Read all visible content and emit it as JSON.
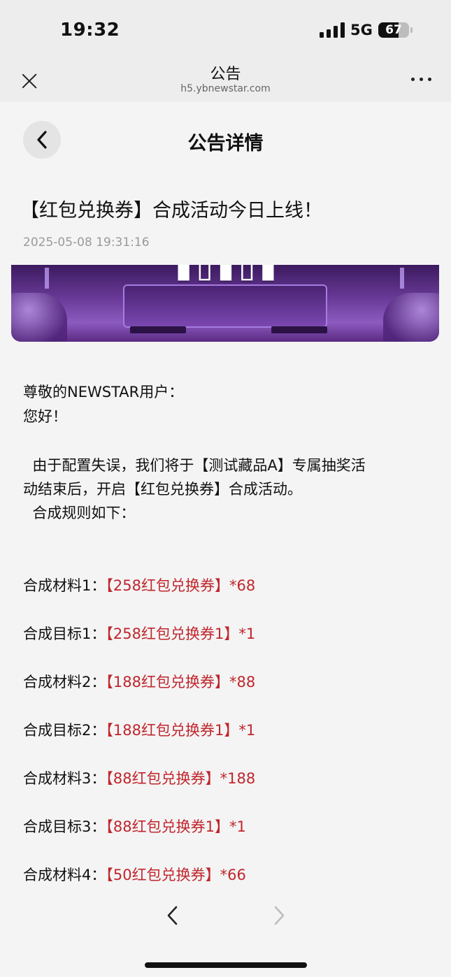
{
  "status_bar": {
    "time": "19:32",
    "network": "5G",
    "battery_level": 67,
    "battery_text": "67"
  },
  "browser": {
    "title": "公告",
    "url": "h5.ybnewstar.com"
  },
  "page": {
    "heading": "公告详情"
  },
  "article": {
    "title": "【红包兑换券】合成活动今日上线！",
    "date": "2025-05-08 19:31:16",
    "greeting_1": "尊敬的NEWSTAR用户：",
    "greeting_2": "您好！",
    "paragraph_line_1": "  由于配置失误，我们将于【测试藏品A】专属抽奖活",
    "paragraph_line_2": "动结束后，开启【红包兑换券】合成活动。",
    "rules_intro": "  合成规则如下：",
    "rules": [
      {
        "label": "合成材料1：",
        "value": "【258红包兑换券】*68"
      },
      {
        "label": "合成目标1：",
        "value": "【258红包兑换券1】*1"
      },
      {
        "label": "合成材料2：",
        "value": "【188红包兑换券】*88"
      },
      {
        "label": "合成目标2：",
        "value": "【188红包兑换券1】*1"
      },
      {
        "label": "合成材料3：",
        "value": "【88红包兑换券】*188"
      },
      {
        "label": "合成目标3：",
        "value": "【88红包兑换券1】*1"
      },
      {
        "label": "合成材料4：",
        "value": "【50红包兑换券】*66"
      }
    ]
  },
  "colors": {
    "highlight": "#c0262d",
    "date_gray": "#9a9a9a",
    "header_bg": "#ededed"
  },
  "icons": {
    "close": "close-icon",
    "more": "more-dots-icon",
    "back": "chevron-left-icon",
    "prev": "chevron-left-icon",
    "next": "chevron-right-icon"
  }
}
